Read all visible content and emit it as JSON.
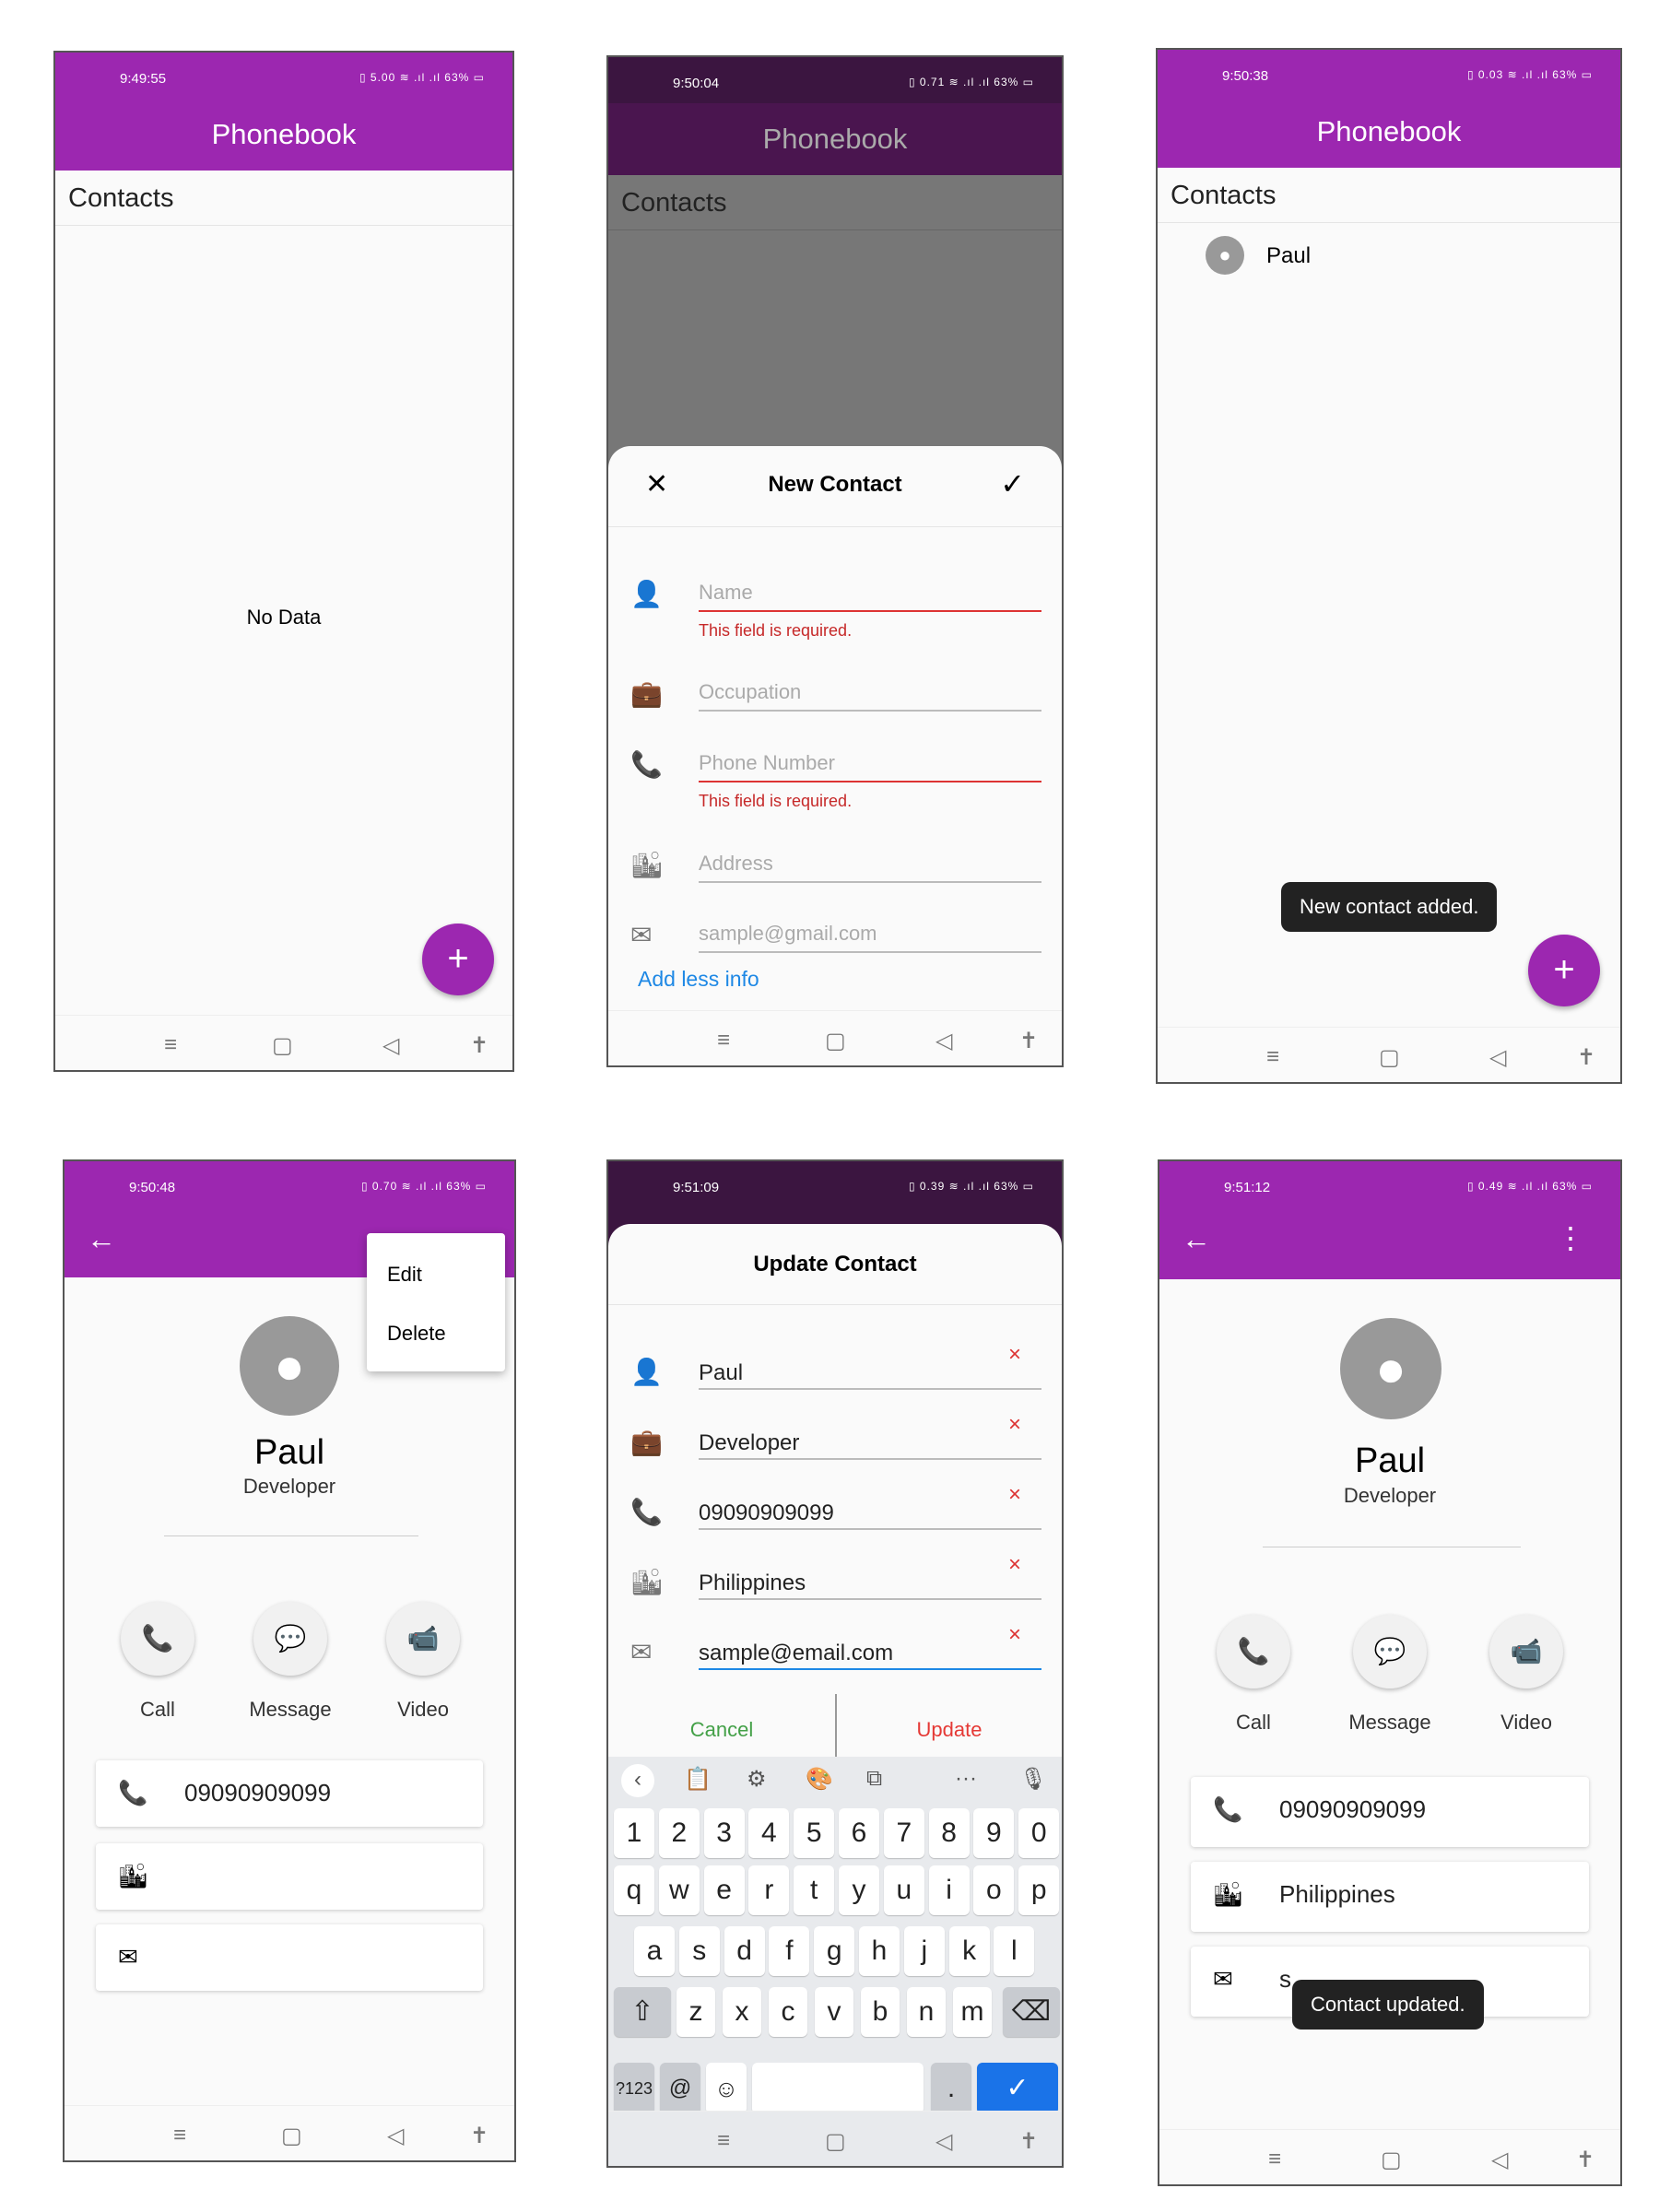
{
  "app_title": "Phonebook",
  "contacts_header": "Contacts",
  "fab_label": "+",
  "nav_icons": [
    "≡",
    "▢",
    "◁",
    "✝"
  ],
  "s1": {
    "time": "9:49:55",
    "status_icons": "▯ 5.00 ≋ .ıl .ıl 63% ▭",
    "empty_text": "No Data"
  },
  "s2": {
    "time": "9:50:04",
    "status_icons": "▯ 0.71 ≋ .ıl .ıl 63% ▭",
    "sheet_title": "New Contact",
    "close_icon": "✕",
    "check_icon": "✓",
    "fields": [
      {
        "icon": "👤",
        "placeholder": "Name",
        "error": "This field is required."
      },
      {
        "icon": "💼",
        "placeholder": "Occupation",
        "error": ""
      },
      {
        "icon": "📞",
        "placeholder": "Phone Number",
        "error": "This field is required."
      },
      {
        "icon": "🏙",
        "placeholder": "Address",
        "error": ""
      },
      {
        "icon": "✉",
        "placeholder": "sample@gmail.com",
        "error": ""
      }
    ],
    "add_less": "Add less info"
  },
  "s3": {
    "time": "9:50:38",
    "status_icons": "▯ 0.03 ≋ .ıl .ıl 63% ▭",
    "contact_name": "Paul",
    "toast": "New contact added."
  },
  "s4": {
    "time": "9:50:48",
    "status_icons": "▯ 0.70 ≋ .ıl .ıl 63% ▭",
    "menu": [
      "Edit",
      "Delete"
    ],
    "name": "Paul",
    "occupation": "Developer",
    "actions": [
      {
        "icon": "📞",
        "label": "Call"
      },
      {
        "icon": "💬",
        "label": "Message"
      },
      {
        "icon": "📹",
        "label": "Video"
      }
    ],
    "phone": "09090909099"
  },
  "s5": {
    "time": "9:51:09",
    "status_icons": "▯ 0.39 ≋ .ıl .ıl 63% ▭",
    "sheet_title": "Update Contact",
    "fields": [
      {
        "icon": "👤",
        "value": "Paul"
      },
      {
        "icon": "💼",
        "value": "Developer"
      },
      {
        "icon": "📞",
        "value": "09090909099"
      },
      {
        "icon": "🏙",
        "value": "Philippines"
      },
      {
        "icon": "✉",
        "value": "sample@email.com"
      }
    ],
    "clear_icon": "×",
    "cancel": "Cancel",
    "update": "Update",
    "toolbar": [
      "‹",
      "📋",
      "⚙",
      "🎨",
      "⧉",
      "···",
      "🎙"
    ],
    "keyboard_rows": [
      [
        "1",
        "2",
        "3",
        "4",
        "5",
        "6",
        "7",
        "8",
        "9",
        "0"
      ],
      [
        "q",
        "w",
        "e",
        "r",
        "t",
        "y",
        "u",
        "i",
        "o",
        "p"
      ],
      [
        "a",
        "s",
        "d",
        "f",
        "g",
        "h",
        "j",
        "k",
        "l"
      ],
      [
        "⇧",
        "z",
        "x",
        "c",
        "v",
        "b",
        "n",
        "m",
        "⌫"
      ]
    ],
    "bottom_keys": {
      "sym": "?123",
      "at": "@",
      "emoji": "☺",
      "dot": ".",
      "enter": "✓"
    }
  },
  "s6": {
    "time": "9:51:12",
    "status_icons": "▯ 0.49 ≋ .ıl .ıl 63% ▭",
    "name": "Paul",
    "occupation": "Developer",
    "actions": [
      {
        "icon": "📞",
        "label": "Call"
      },
      {
        "icon": "💬",
        "label": "Message"
      },
      {
        "icon": "📹",
        "label": "Video"
      }
    ],
    "phone": "09090909099",
    "address": "Philippines",
    "email_partial": "s",
    "toast": "Contact updated."
  }
}
